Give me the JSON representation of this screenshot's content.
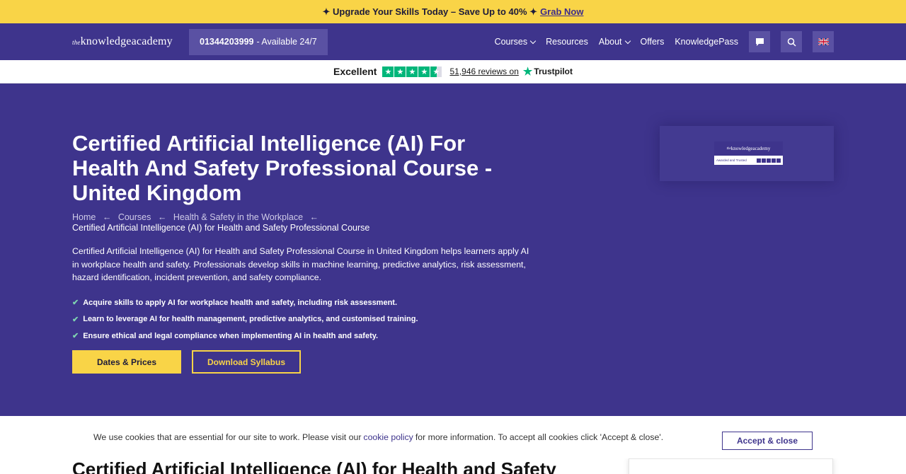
{
  "promo": {
    "text": "✦ Upgrade Your Skills Today – Save Up to 40% ✦",
    "link": "Grab Now"
  },
  "nav": {
    "logo_prefix": "the",
    "logo_text": "knowledgeacademy",
    "phone_number": "01344203999",
    "phone_suffix": " - Available 24/7",
    "links": [
      "Courses",
      "Resources",
      "About",
      "Offers",
      "KnowledgePass"
    ],
    "icons": [
      "chat-icon",
      "search-icon",
      "uk-flag-icon"
    ]
  },
  "trustpilot": {
    "rating_word": "Excellent",
    "stars": 4.5,
    "reviews": "51,946 reviews on",
    "brand": "Trustpilot"
  },
  "hero": {
    "title": "Certified Artificial Intelligence (AI) For Health And Safety Professional Course - United Kingdom",
    "breadcrumb": [
      "Home",
      "Courses",
      "Health & Safety in the Workplace"
    ],
    "breadcrumb_current": "Certified Artificial Intelligence (AI) for Health and Safety Professional Course",
    "description": "Certified Artificial Intelligence (AI) for Health and Safety Professional Course in United Kingdom helps learners apply AI in workplace health and safety. Professionals develop skills in machine learning, predictive analytics, risk assessment, hazard identification, incident prevention, and safety compliance.",
    "bullets": [
      "Acquire skills to apply AI for workplace health and safety, including risk assessment.",
      "Learn to leverage AI for health management, predictive analytics, and customised training.",
      "Ensure ethical and legal compliance when implementing AI in health and safety."
    ],
    "btn_dates": "Dates & Prices",
    "btn_syllabus": "Download Syllabus",
    "badge_logo_prefix": "the",
    "badge_logo": "knowledgeacademy",
    "badge_caption": "Awarded and Trusted"
  },
  "below": {
    "title": "Certified Artificial Intelligence (AI) for Health and Safety"
  },
  "cookie": {
    "text_before": "We use cookies that are essential for our site to work. Please visit our",
    "policy_link": "cookie policy",
    "text_after": "for more information. To accept all cookies click 'Accept & close'.",
    "accept": "Accept & close"
  },
  "colors": {
    "brand_purple": "#3e348c",
    "accent_yellow": "#f9d447",
    "trustpilot_green": "#00b67a"
  }
}
